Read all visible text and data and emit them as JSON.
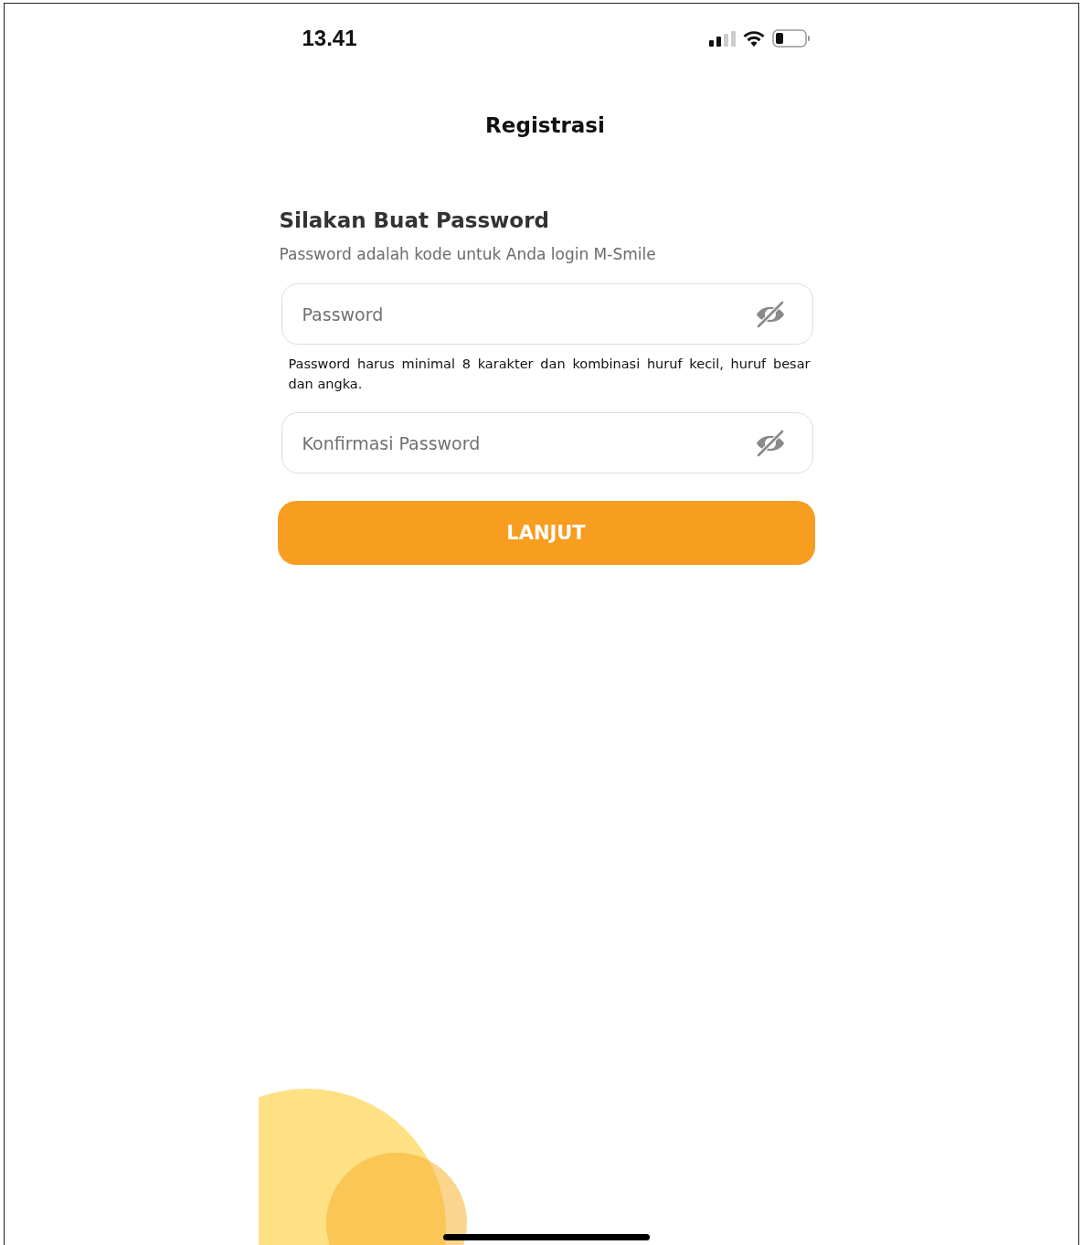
{
  "status_bar": {
    "time": "13.41"
  },
  "header": {
    "title": "Registrasi"
  },
  "form": {
    "heading": "Silakan Buat Password",
    "subtitle": "Password adalah kode untuk Anda login M-Smile",
    "fields": [
      {
        "placeholder": "Password",
        "hint": "Password harus minimal 8 karakter dan kombinasi huruf kecil, huruf besar dan angka."
      },
      {
        "placeholder": "Konfirmasi Password"
      }
    ],
    "button": "LANJUT"
  }
}
